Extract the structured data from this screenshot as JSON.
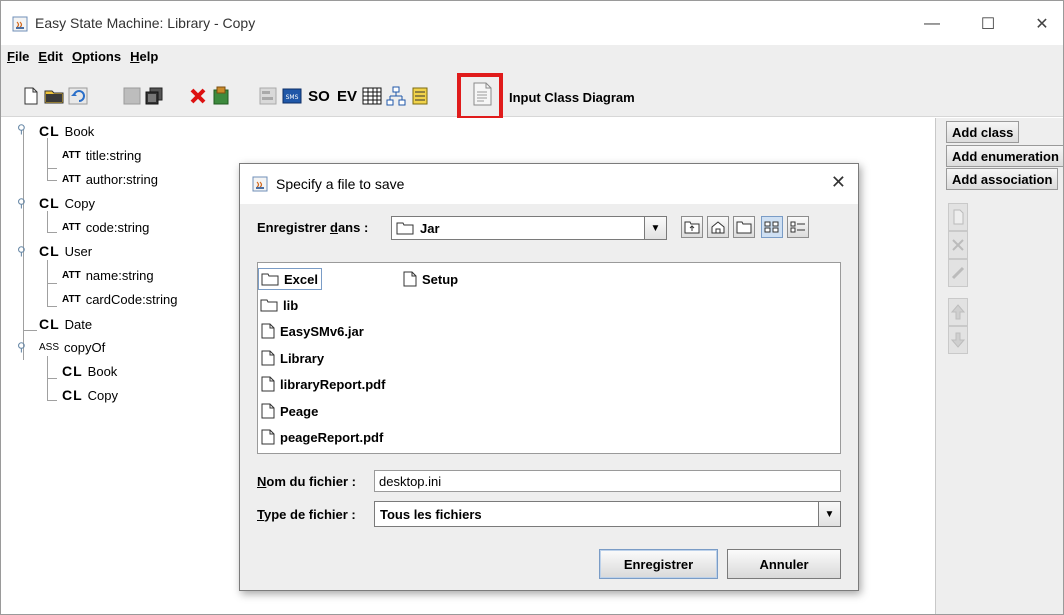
{
  "window": {
    "title": "Easy State Machine: Library - Copy",
    "controls": {
      "minimize": "—",
      "maximize": "☐",
      "close": "✕"
    }
  },
  "menu": {
    "items": [
      {
        "label": "File",
        "mnemonic": "F",
        "rest": "ile"
      },
      {
        "label": "Edit",
        "mnemonic": "E",
        "rest": "dit"
      },
      {
        "label": "Options",
        "mnemonic": "O",
        "rest": "ptions"
      },
      {
        "label": "Help",
        "mnemonic": "H",
        "rest": "elp"
      }
    ]
  },
  "toolbar": {
    "text_buttons": {
      "so": "SO",
      "ev": "EV",
      "sms": "SMS"
    },
    "label": "Input Class Diagram"
  },
  "tree": {
    "badges": {
      "class": "CL",
      "attribute": "ATT",
      "association": "ASS"
    },
    "nodes": [
      {
        "kind": "class",
        "text": "Book"
      },
      {
        "kind": "attribute",
        "text": "title:string"
      },
      {
        "kind": "attribute",
        "text": "author:string"
      },
      {
        "kind": "class",
        "text": "Copy"
      },
      {
        "kind": "attribute",
        "text": "code:string"
      },
      {
        "kind": "class",
        "text": "User"
      },
      {
        "kind": "attribute",
        "text": "name:string"
      },
      {
        "kind": "attribute",
        "text": "cardCode:string"
      },
      {
        "kind": "class",
        "text": "Date"
      },
      {
        "kind": "association",
        "text": "copyOf"
      },
      {
        "kind": "class",
        "text": "Book"
      },
      {
        "kind": "class",
        "text": "Copy"
      }
    ]
  },
  "right_panel": {
    "add_class": "Add class",
    "add_enumeration": "Add enumeration",
    "add_association": "Add association"
  },
  "dialog": {
    "title": "Specify a file to save",
    "close": "✕",
    "save_in_label_pre": "Enregistrer ",
    "save_in_label_mn": "d",
    "save_in_label_post": "ans :",
    "current_folder": "Jar",
    "files": [
      {
        "name": "Excel",
        "type": "folder",
        "selected": true
      },
      {
        "name": "Setup",
        "type": "file"
      },
      {
        "name": "lib",
        "type": "folder"
      },
      {
        "name": "EasySMv6.jar",
        "type": "file"
      },
      {
        "name": "Library",
        "type": "file"
      },
      {
        "name": "libraryReport.pdf",
        "type": "file"
      },
      {
        "name": "Peage",
        "type": "file"
      },
      {
        "name": "peageReport.pdf",
        "type": "file"
      }
    ],
    "filename_label_mn": "N",
    "filename_label_rest": "om du fichier :",
    "filename_value": "desktop.ini",
    "filetype_label_mn": "T",
    "filetype_label_rest": "ype de fichier :",
    "filetype_value": "Tous les fichiers",
    "save_button": "Enregistrer",
    "cancel_button": "Annuler"
  },
  "colors": {
    "highlight": "#e01b1b",
    "toolbar_bg": "#eeeeee",
    "selection_border": "#7a9cc6"
  }
}
